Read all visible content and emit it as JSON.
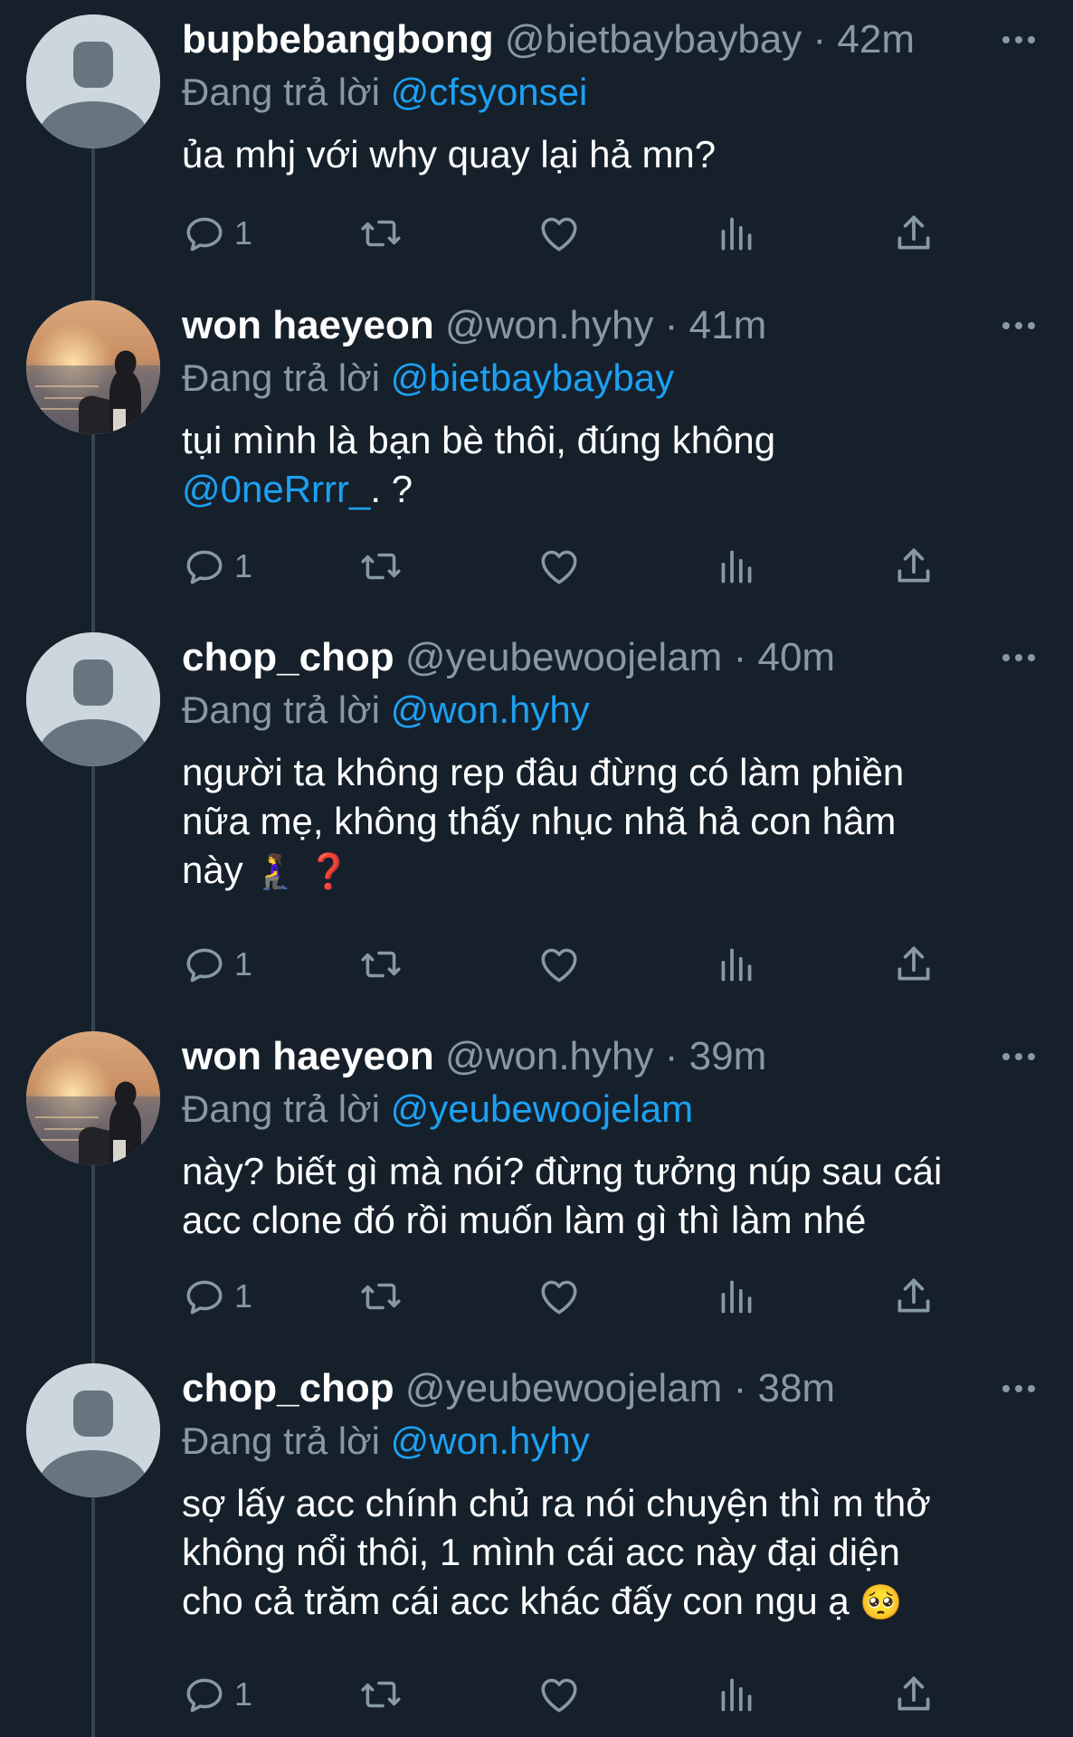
{
  "colors": {
    "background": "#15202b",
    "text": "#ffffff",
    "muted": "#8899a6",
    "mention": "#1da1f2",
    "thread_line": "#38444d"
  },
  "replying_prefix": "Đang trả lời",
  "more_icon": "more-horizontal-icon",
  "action_icons": [
    "reply-icon",
    "retweet-icon",
    "like-icon",
    "analytics-icon",
    "share-icon"
  ],
  "tweets": [
    {
      "name": "bupbebangbong",
      "handle": "@bietbaybaybay",
      "separator": "·",
      "time": "42m",
      "reply_to": "@cfsyonsei",
      "avatar": "default",
      "text_lines": [
        [
          {
            "t": "ủa mhj với why quay lại hả mn?"
          }
        ]
      ],
      "reply_count": "1"
    },
    {
      "name": "won haeyeon",
      "handle": "@won.hyhy",
      "separator": "·",
      "time": "41m",
      "reply_to": "@bietbaybaybay",
      "avatar": "photo",
      "text_lines": [
        [
          {
            "t": "tụi mình là bạn bè thôi, đúng không"
          }
        ],
        [
          {
            "t": "@0neRrrr_",
            "mention": true
          },
          {
            "t": ". ?"
          }
        ]
      ],
      "reply_count": "1"
    },
    {
      "name": "chop_chop",
      "handle": "@yeubewoojelam",
      "separator": "·",
      "time": "40m",
      "reply_to": "@won.hyhy",
      "avatar": "default",
      "text_lines": [
        [
          {
            "t": "người ta không rep đâu đừng có làm phiền"
          }
        ],
        [
          {
            "t": "nữa mẹ, không thấy nhục nhã hả con hâm"
          }
        ],
        [
          {
            "t": "này "
          },
          {
            "t": "🧎‍♀️ ❓",
            "emoji": true
          }
        ]
      ],
      "reply_count": "1"
    },
    {
      "name": "won haeyeon",
      "handle": "@won.hyhy",
      "separator": "·",
      "time": "39m",
      "reply_to": "@yeubewoojelam",
      "avatar": "photo",
      "text_lines": [
        [
          {
            "t": "này? biết gì mà nói? đừng tưởng núp sau cái"
          }
        ],
        [
          {
            "t": "acc clone đó rồi muốn làm gì thì làm nhé"
          }
        ]
      ],
      "reply_count": "1"
    },
    {
      "name": "chop_chop",
      "handle": "@yeubewoojelam",
      "separator": "·",
      "time": "38m",
      "reply_to": "@won.hyhy",
      "avatar": "default",
      "text_lines": [
        [
          {
            "t": "sợ lấy acc chính chủ ra nói chuyện thì m thở"
          }
        ],
        [
          {
            "t": "không nổi thôi, 1 mình cái acc này đại diện"
          }
        ],
        [
          {
            "t": "cho cả trăm cái acc khác đấy con ngu ạ "
          },
          {
            "t": "🥺",
            "emoji": true
          }
        ]
      ],
      "reply_count": "1"
    }
  ]
}
